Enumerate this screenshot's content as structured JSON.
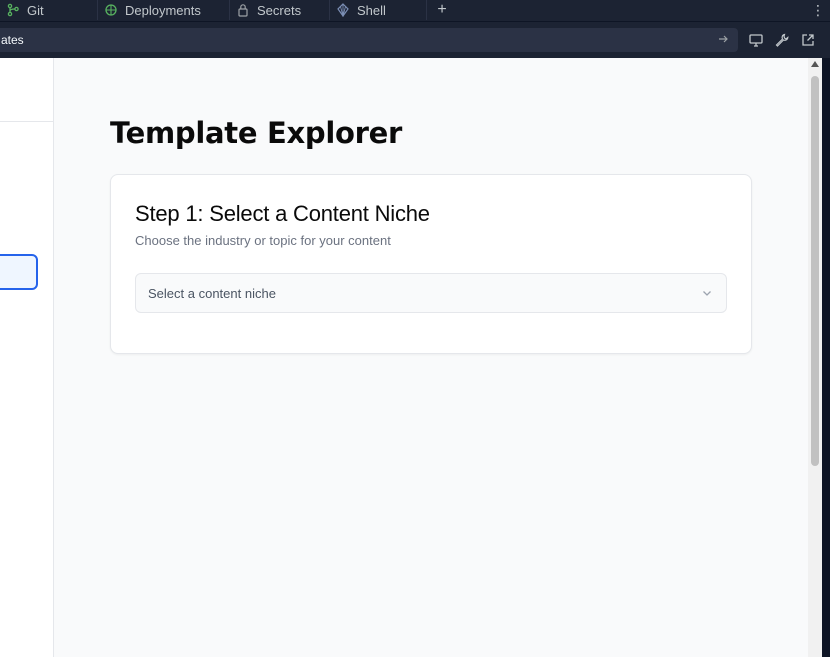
{
  "tabs": [
    {
      "label": "Git",
      "icon": "git-branch-icon"
    },
    {
      "label": "Deployments",
      "icon": "deployments-icon"
    },
    {
      "label": "Secrets",
      "icon": "lock-icon"
    },
    {
      "label": "Shell",
      "icon": "shell-icon"
    }
  ],
  "tab_add_label": "+",
  "url_bar": {
    "value": "ates"
  },
  "page": {
    "title": "Template Explorer",
    "step_title": "Step 1: Select a Content Niche",
    "step_description": "Choose the industry or topic for your content",
    "select_placeholder": "Select a content niche"
  },
  "colors": {
    "accent": "#2563eb",
    "ide_bg": "#1c2333",
    "git_green": "#58b360"
  }
}
